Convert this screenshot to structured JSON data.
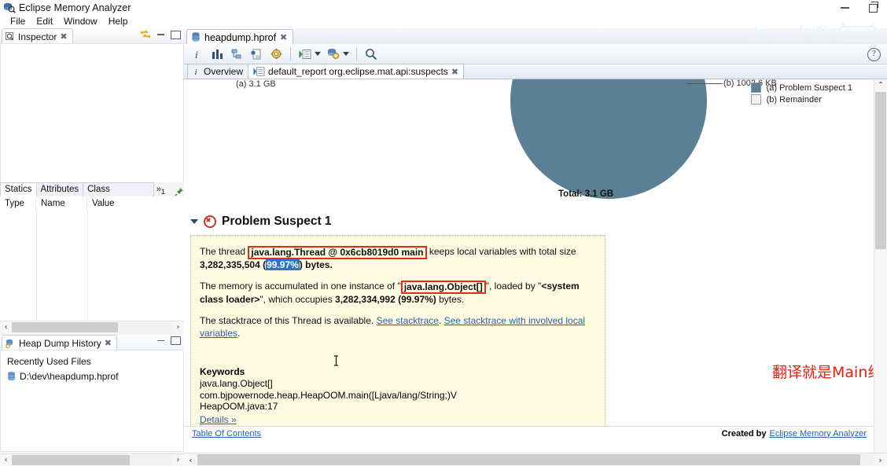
{
  "window": {
    "title": "Eclipse Memory Analyzer",
    "app_icon": "memory-analyzer-icon",
    "minimize_label": "Minimize",
    "restore_label": "Restore"
  },
  "menubar": {
    "items": [
      "File",
      "Edit",
      "Window",
      "Help"
    ]
  },
  "watermark": {
    "text": "Java小酱",
    "logo": "bilibili"
  },
  "inspector": {
    "tab_label": "Inspector",
    "tab_icon": "inspector-icon",
    "close_glyph": "✖",
    "tools": [
      "sync-icon",
      "minimize-icon",
      "maximize-icon"
    ],
    "sub_tabs": [
      {
        "label": "Statics",
        "active": true
      },
      {
        "label": "Attributes",
        "active": false
      },
      {
        "label": "Class Hierarchy",
        "active": false
      }
    ],
    "overflow_label": "»",
    "overflow_count": "1",
    "pin_icon": "pin-icon",
    "columns": [
      "Type",
      "Name",
      "Value"
    ],
    "rows": []
  },
  "heap_dump_history": {
    "tab_label": "Heap Dump History",
    "tab_icon": "history-icon",
    "close_glyph": "✖",
    "section_label": "Recently Used Files",
    "files": [
      {
        "icon": "heapdump-file-icon",
        "path": "D:\\dev\\heapdump.hprof"
      }
    ]
  },
  "editor": {
    "tab_label": "heapdump.hprof",
    "tab_icon": "heapdump-file-icon",
    "close_glyph": "✖",
    "toolbar": [
      {
        "name": "overview-info-icon",
        "glyph": "i"
      },
      {
        "name": "histogram-icon",
        "glyph": "bars"
      },
      {
        "name": "dominator-tree-icon",
        "glyph": "tree"
      },
      {
        "name": "oql-icon",
        "glyph": "page"
      },
      {
        "name": "gear-icon",
        "glyph": "gear"
      },
      {
        "name": "run-expert-system-icon",
        "glyph": "run"
      },
      {
        "name": "run-expert-dropdown",
        "glyph": "caret"
      },
      {
        "name": "query-browser-icon",
        "glyph": "query"
      },
      {
        "name": "query-browser-dropdown",
        "glyph": "caret"
      },
      {
        "name": "search-icon",
        "glyph": "magnifier"
      }
    ],
    "help_glyph": "?",
    "inner_tabs": [
      {
        "label": "Overview",
        "icon": "info-icon",
        "active": false
      },
      {
        "label": "default_report org.eclipse.mat.api:suspects",
        "icon": "report-icon",
        "active": true,
        "closeable": true
      }
    ]
  },
  "chart_data": {
    "type": "pie",
    "title": "Total: 3.1 GB",
    "total_label": "Total: 3.1 GB",
    "categories": [
      "(a) Problem Suspect 1",
      "(b) Remainder"
    ],
    "values": [
      3.1,
      0.0009775
    ],
    "value_labels": [
      "(a) 3.1 GB",
      "(b) 1002.6 KB"
    ],
    "units": "GB",
    "colors": [
      "#5b7f93",
      "#f2f2f2"
    ],
    "legend": [
      {
        "key": "(a)",
        "label": "(a) Problem Suspect 1",
        "color": "#5b7f93"
      },
      {
        "key": "(b)",
        "label": "(b) Remainder",
        "color": "#f2f2f2"
      }
    ],
    "legend_position": "top-right",
    "grid": false
  },
  "suspect": {
    "heading": "Problem Suspect 1",
    "error_icon": "error-icon",
    "twisty": "expanded",
    "paragraph1": {
      "prefix": "The thread ",
      "highlight": "java.lang.Thread @ 0x6cb8019d0 main",
      "middle": " keeps local variables with total size ",
      "size_bytes": "3,282,335,504",
      "open_paren": " (",
      "selected_percent": "99.97%",
      "suffix": ") bytes."
    },
    "paragraph2": {
      "prefix": "The memory is accumulated in one instance of \"",
      "highlight": "java.lang.Object[]",
      "middle": "\", loaded by \"",
      "loader": "<system class loader>",
      "middle2": "\", which occupies ",
      "size_bytes": "3,282,334,992 (99.97%)",
      "suffix": " bytes."
    },
    "paragraph3": {
      "prefix": "The stacktrace of this Thread is available. ",
      "link1": "See stacktrace",
      "sep": ". ",
      "link2": "See stacktrace with involved local variables",
      "suffix": "."
    },
    "keywords_title": "Keywords",
    "keywords": [
      "java.lang.Object[]",
      "com.bjpowernode.heap.HeapOOM.main([Ljava/lang/String;)V",
      "HeapOOM.java:17"
    ],
    "details_link": "Details »"
  },
  "annotation": {
    "text": "翻译就是Main线程有一个Object数组很大",
    "color": "#f21b0c"
  },
  "report_footer": {
    "toc_link": "Table Of Contents",
    "created_by_prefix": "Created by",
    "created_by_link": "Eclipse Memory Analyzer"
  },
  "scrollbars": {
    "left_arrow": "‹",
    "right_arrow": "›",
    "up_arrow": "⌃",
    "down_arrow": "⌄"
  }
}
